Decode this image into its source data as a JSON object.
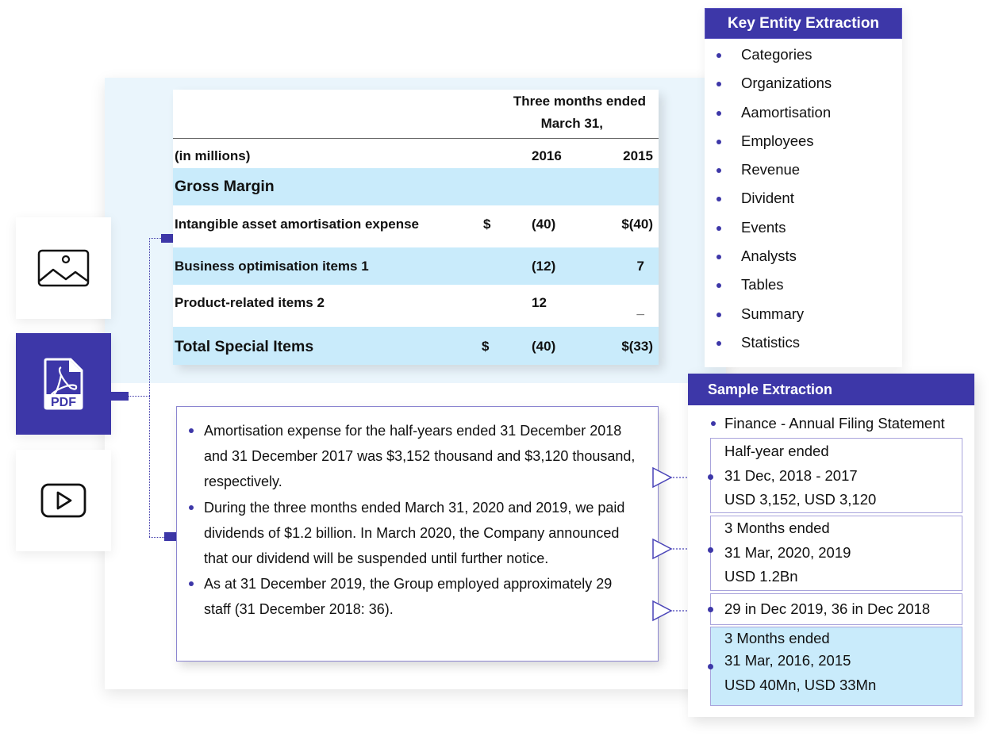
{
  "sources": [
    {
      "name": "image",
      "icon": "image-icon",
      "active": false
    },
    {
      "name": "pdf",
      "icon": "pdf-file-icon",
      "label": "PDF",
      "active": true
    },
    {
      "name": "video",
      "icon": "play-icon",
      "active": false
    }
  ],
  "table": {
    "header_line1": "Three months ended",
    "header_line2": "March 31,",
    "unit_label": "(in millions)",
    "col1": "2016",
    "col2": "2015",
    "section": "Gross Margin",
    "rows": [
      {
        "label": "Intangible asset amortisation expense",
        "dollar": "$",
        "v1": "(40)",
        "v2": "$(40)"
      },
      {
        "label": "Business optimisation items 1",
        "dollar": "",
        "v1": "(12)",
        "v2": "7"
      },
      {
        "label": "Product-related items 2",
        "dollar": "",
        "v1": "12",
        "v2": "_"
      },
      {
        "label": "Total Special Items",
        "dollar": "$",
        "v1": "(40)",
        "v2": "$(33)"
      }
    ]
  },
  "text_box": {
    "bullets": [
      "Amortisation expense for the half-years ended 31 December 2018 and 31 December 2017 was $3,152 thousand and $3,120 thousand, respectively.",
      "During the three months ended March 31, 2020 and 2019, we paid dividends of $1.2 billion. In March 2020, the Company announced that our dividend will be suspended until further notice.",
      "As at 31 December 2019, the Group employed approximately 29 staff (31 December 2018: 36)."
    ]
  },
  "key_entity": {
    "title": "Key Entity Extraction",
    "items": [
      "Categories",
      "Organizations",
      "Aamortisation",
      "Employees",
      "Revenue",
      "Divident",
      "Events",
      "Analysts",
      "Tables",
      "Summary",
      "Statistics"
    ]
  },
  "sample": {
    "title": "Sample Extraction",
    "doc_type": "Finance - Annual Filing Statement",
    "boxes": [
      {
        "lines": [
          "Half-year ended",
          "31 Dec, 2018 - 2017",
          "USD 3,152, USD 3,120"
        ]
      },
      {
        "lines": [
          "3 Months ended",
          "31 Mar, 2020, 2019",
          "USD 1.2Bn"
        ]
      },
      {
        "lines": [
          "29 in Dec 2019, 36 in Dec 2018"
        ]
      },
      {
        "lines": [
          "3 Months ended",
          "31 Mar, 2016, 2015",
          "USD 40Mn, USD 33Mn"
        ]
      }
    ]
  },
  "colors": {
    "accent": "#3d37a8",
    "highlight": "#c9ebfb",
    "panel_tint": "#eaf5fc"
  }
}
